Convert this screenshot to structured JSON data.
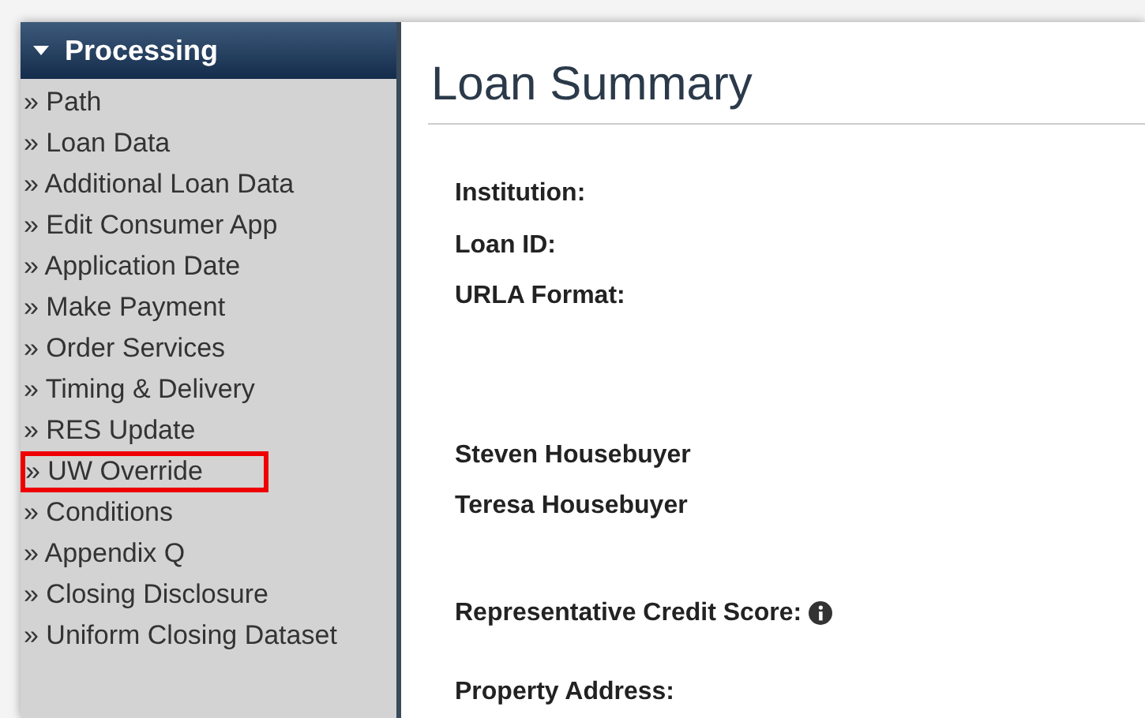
{
  "sidebar": {
    "header": {
      "label": "Processing",
      "expanded": true
    },
    "items": [
      {
        "label": "» Path",
        "highlighted": false
      },
      {
        "label": "» Loan Data",
        "highlighted": false
      },
      {
        "label": "» Additional Loan Data",
        "highlighted": false
      },
      {
        "label": "» Edit Consumer App",
        "highlighted": false
      },
      {
        "label": "» Application Date",
        "highlighted": false
      },
      {
        "label": "» Make Payment",
        "highlighted": false
      },
      {
        "label": "» Order Services",
        "highlighted": false
      },
      {
        "label": "» Timing & Delivery",
        "highlighted": false
      },
      {
        "label": "» RES Update",
        "highlighted": false
      },
      {
        "label": "» UW Override",
        "highlighted": true
      },
      {
        "label": "» Conditions",
        "highlighted": false
      },
      {
        "label": "» Appendix Q",
        "highlighted": false
      },
      {
        "label": "» Closing Disclosure",
        "highlighted": false
      },
      {
        "label": "» Uniform Closing Dataset",
        "highlighted": false
      }
    ]
  },
  "main": {
    "title": "Loan Summary",
    "fields": [
      {
        "label": "Institution:"
      },
      {
        "label": "Loan ID:"
      },
      {
        "label": "URLA Format:"
      }
    ],
    "borrowers": [
      "Steven Housebuyer",
      "Teresa Housebuyer"
    ],
    "credit_score": {
      "label": "Representative Credit Score:"
    },
    "property": {
      "label": "Property Address:"
    }
  }
}
